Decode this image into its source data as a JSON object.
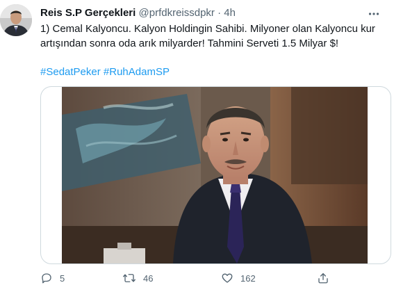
{
  "tweet": {
    "display_name": "Reis S.P Gerçekleri",
    "handle": "@prfdkreissdpkr",
    "separator": "·",
    "time": "4h",
    "text": "1) Cemal Kalyoncu. Kalyon Holdingin Sahibi. Milyoner olan Kalyoncu kur artışından sonra oda arık milyarder! Tahmini Serveti 1.5 Milyar $!",
    "hashtags": [
      "#SedatPeker",
      "#RuhAdamSP"
    ],
    "actions": {
      "reply": {
        "icon": "reply-icon",
        "count": "5"
      },
      "retweet": {
        "icon": "retweet-icon",
        "count": "46"
      },
      "like": {
        "icon": "heart-icon",
        "count": "162"
      },
      "share": {
        "icon": "share-icon"
      }
    },
    "more_icon": "more-horizontal-icon"
  },
  "colors": {
    "text": "#0f1419",
    "secondary": "#536471",
    "link": "#1d9bf0",
    "border": "#cfd9de"
  }
}
